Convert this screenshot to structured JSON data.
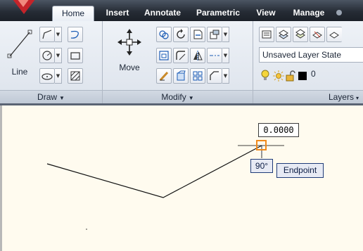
{
  "tabs": [
    {
      "label": "Home",
      "active": true
    },
    {
      "label": "Insert",
      "active": false
    },
    {
      "label": "Annotate",
      "active": false
    },
    {
      "label": "Parametric",
      "active": false
    },
    {
      "label": "View",
      "active": false
    },
    {
      "label": "Manage",
      "active": false
    }
  ],
  "ribbon": {
    "draw": {
      "title": "Draw",
      "line_label": "Line"
    },
    "modify": {
      "title": "Modify",
      "move_label": "Move"
    },
    "layers": {
      "title": "Layers",
      "layer_state": "Unsaved Layer State",
      "current_layer": "0"
    }
  },
  "canvas": {
    "dynamic_input": "0.0000",
    "polar_angle": "90°",
    "snap_label": "Endpoint"
  },
  "colors": {
    "snap_marker": "#f08a1c",
    "tooltip_border": "#1f3b78",
    "app_button": "#c4242a"
  }
}
